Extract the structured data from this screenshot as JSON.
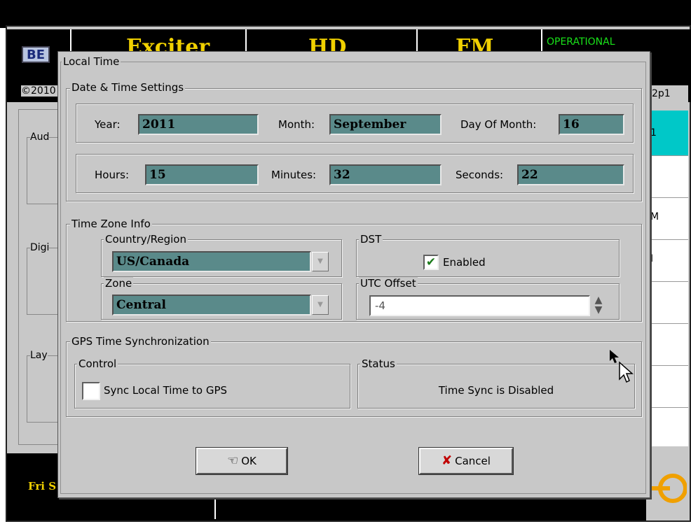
{
  "background": {
    "header_tabs": [
      "Exciter",
      "HD",
      "FM"
    ],
    "operational_status": "OPERATIONAL",
    "logo_text": "BE",
    "copyright": "©2010",
    "version": "2p1",
    "left_groups": [
      "Aud",
      "Digi",
      "Lay"
    ],
    "right_items": [
      "1",
      "",
      "M",
      "I"
    ],
    "footer_date": "Fri S"
  },
  "dialog": {
    "title": "Local Time",
    "datetime": {
      "label": "Date & Time Settings",
      "year_label": "Year:",
      "year": "2011",
      "month_label": "Month:",
      "month": "September",
      "day_label": "Day Of Month:",
      "day": "16",
      "hours_label": "Hours:",
      "hours": "15",
      "minutes_label": "Minutes:",
      "minutes": "32",
      "seconds_label": "Seconds:",
      "seconds": "22"
    },
    "timezone": {
      "label": "Time Zone Info",
      "country_label": "Country/Region",
      "country": "US/Canada",
      "zone_label": "Zone",
      "zone": "Central",
      "dst_label": "DST",
      "dst_checkbox_label": "Enabled",
      "dst_checked": true,
      "utc_label": "UTC Offset",
      "utc_value": "-4"
    },
    "gps": {
      "label": "GPS Time Synchronization",
      "control_label": "Control",
      "sync_checkbox_label": "Sync Local Time to GPS",
      "sync_checked": false,
      "status_label": "Status",
      "status_text": "Time Sync is Disabled"
    },
    "buttons": {
      "ok": "OK",
      "cancel": "Cancel"
    }
  },
  "colors": {
    "field_bg": "#5a8a8a",
    "header_text": "#f0d000",
    "operational": "#19e319",
    "cyan": "#00c8c8"
  }
}
